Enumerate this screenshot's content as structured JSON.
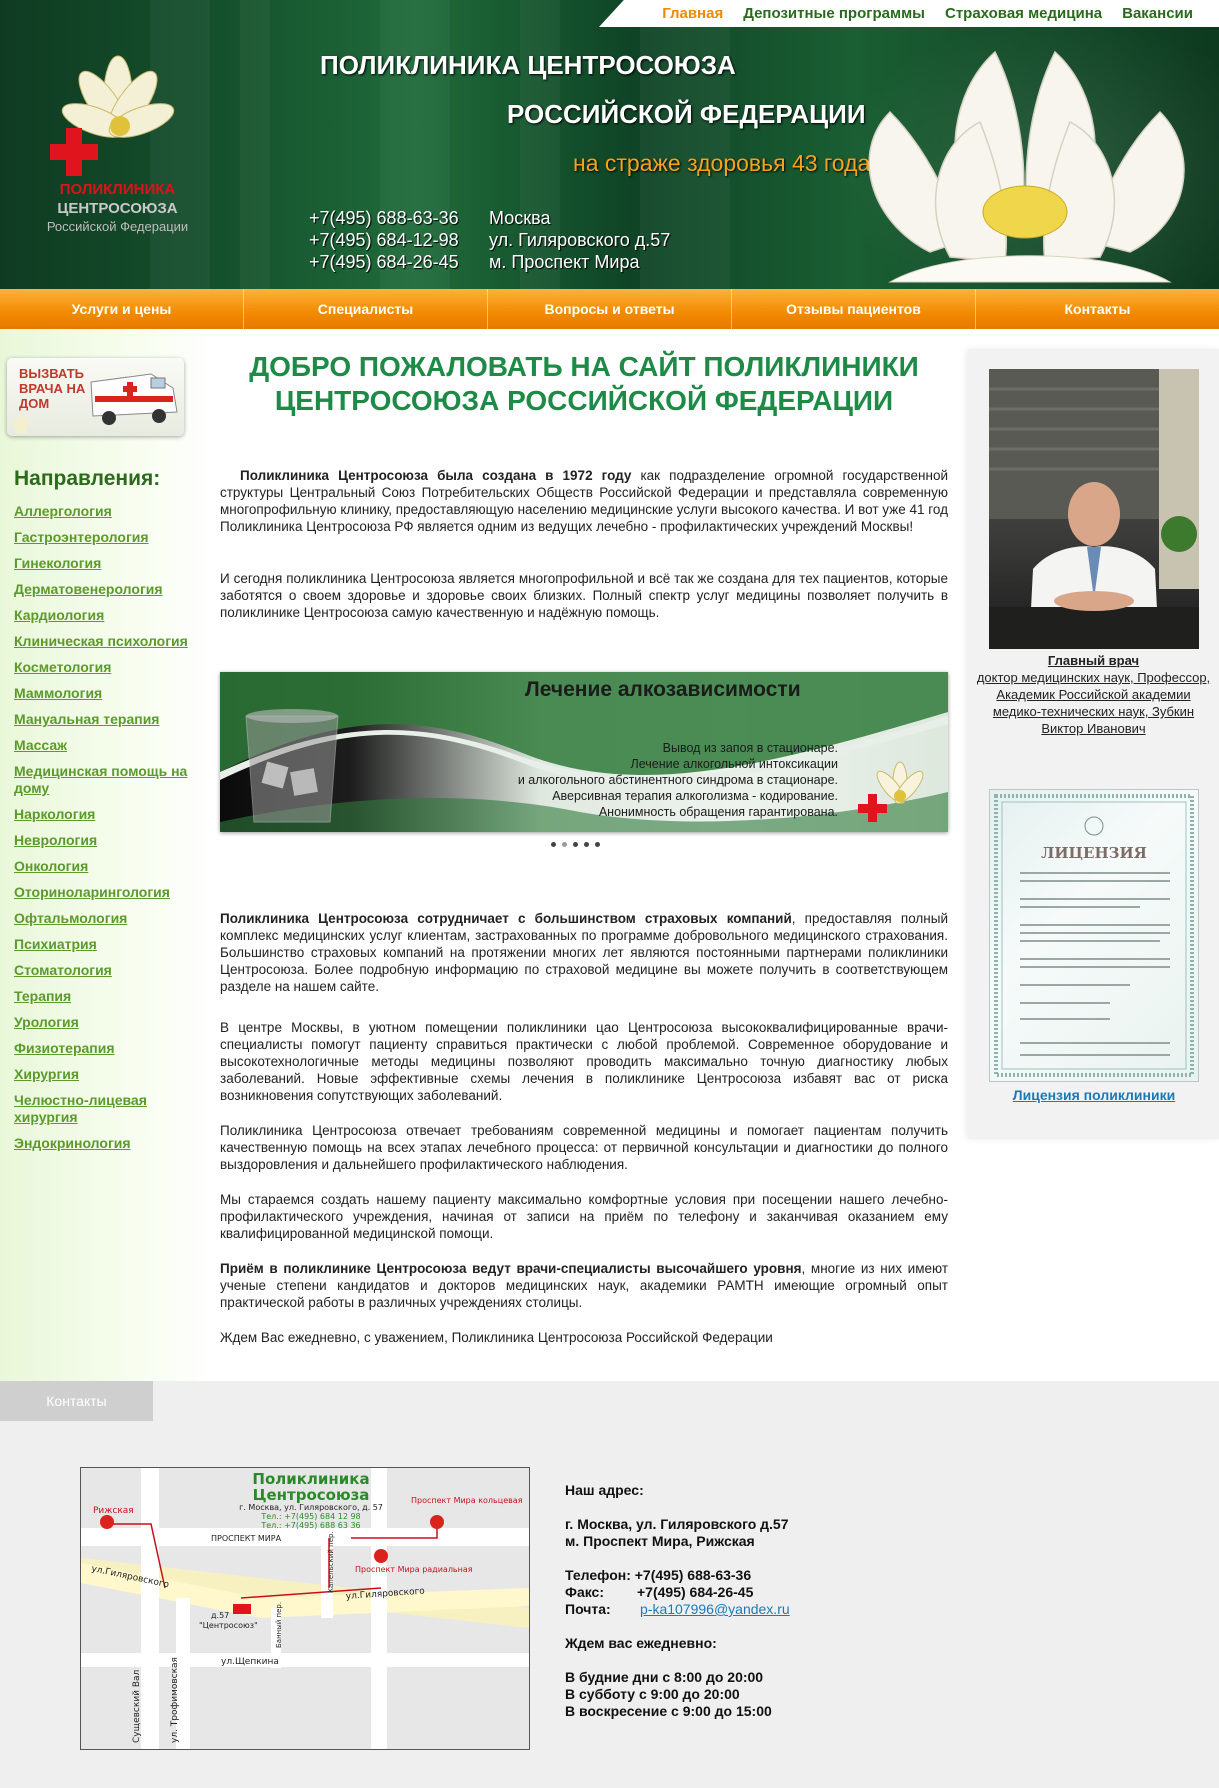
{
  "topnav": {
    "items": [
      {
        "label": "Главная",
        "active": true
      },
      {
        "label": "Депозитные программы"
      },
      {
        "label": "Страховая медицина"
      },
      {
        "label": "Вакансии"
      }
    ]
  },
  "logo": {
    "line1": "ПОЛИКЛИНИКА",
    "line2": "ЦЕНТРОСОЮЗА",
    "line3": "Российской Федерации"
  },
  "header": {
    "title1": "ПОЛИКЛИНИКА ЦЕНТРОСОЮЗА",
    "title2": "РОССИЙСКОЙ ФЕДЕРАЦИИ",
    "slogan": "на страже здоровья 43 года!",
    "phones": [
      "+7(495) 688-63-36",
      "+7(495) 684-12-98",
      "+7(495) 684-26-45"
    ],
    "address": [
      "Москва",
      "ул. Гиляровского д.57",
      "м. Проспект Мира"
    ]
  },
  "mainmenu": [
    "Услуги и цены",
    "Специалисты",
    "Вопросы и ответы",
    "Отзывы пациентов",
    "Контакты"
  ],
  "sidebar": {
    "call_button": "ВЫЗВАТЬ ВРАЧА НА ДОМ",
    "heading": "Направления:",
    "items": [
      "Аллергология",
      "Гастроэнтерология",
      "Гинекология",
      "Дерматовенерология",
      "Кардиология",
      "Клиническая психология",
      "Косметология",
      "Маммология",
      "Мануальная терапия",
      "Массаж",
      "Медицинская помощь на дому",
      "Наркология",
      "Неврология",
      "Онкология",
      "Оториноларингология",
      "Офтальмология",
      "Психиатрия",
      "Стоматология",
      "Терапия",
      "Урология",
      "Физиотерапия",
      "Хирургия",
      "Челюстно-лицевая хирургия",
      "Эндокринология"
    ]
  },
  "main": {
    "welcome": "ДОБРО ПОЖАЛОВАТЬ НА САЙТ ПОЛИКЛИНИКИ ЦЕНТРОСОЮЗА РОССИЙСКОЙ ФЕДЕРАЦИИ",
    "intro_bold": "Поликлиника Центросоюза была создана в 1972 году",
    "intro_rest": " как подразделение огромной государственной структуры Центральный Союз Потребительских Обществ Российской Федерации и представляла современную многопрофильную клинику, предоставляющую населению медицинские услуги высокого качества. И вот уже  41 год Поликлиника Центросоюза РФ является одним из ведущих лечебно - профилактических учреждений  Москвы!",
    "p2": "И сегодня поликлиника Центросоюза является многопрофильной и всё так же создана для тех пациентов, которые заботятся о своем здоровье и здоровье своих близких. Полный спектр услуг медицины позволяет получить в поликлинике Центросоюза самую качественную и надёжную помощь.",
    "banner": {
      "title": "Лечение алкозависимости",
      "lines": [
        "Вывод из запоя в стационаре.",
        "Лечение алкогольной интоксикации",
        "и алкогольного абстинентного синдрома в стационаре.",
        "Аверсивная терапия алкоголизма - кодирование.",
        "Анонимность обращения гарантирована."
      ]
    },
    "p3_bold": "Поликлиника Центросоюза сотрудничает с большинством страховых компаний",
    "p3_rest": ", предоставляя полный комплекс медицинских услуг клиентам, застрахованных по программе добровольного медицинского страхования. Большинство страховых компаний на протяжении многих лет являются постоянными партнерами поликлиники Центросоюза. Более подробную информацию по страховой медицине вы можете получить в соответствующем разделе на нашем сайте.",
    "p4": "В центре Москвы, в уютном помещении  поликлиники цао Центросоюза высококвалифицированные врачи-специалисты помогут пациенту справиться практически с любой проблемой. Современное оборудование и высокотехнологичные методы медицины позволяют проводить максимально точную диагностику любых заболеваний.  Новые эффективные схемы лечения в поликлинике Центросоюза избавят вас от риска возникновения сопутствующих заболеваний.",
    "p5": "Поликлиника Центросоюза отвечает требованиям современной медицины и помогает пациентам получить качественную помощь на всех этапах лечебного процесса: от первичной консультации и диагностики до полного выздоровления и дальнейшего профилактического наблюдения.",
    "p6": "Мы стараемся создать нашему пациенту максимально комфортные условия при посещении нашего лечебно-профилактического учреждения, начиная от записи на приём по телефону и заканчивая оказанием ему квалифицированной медицинской помощи.",
    "p7_bold": "Приём в поликлинике Центросоюза ведут врачи-специалисты высочайшего уровня",
    "p7_rest": ", многие из них имеют ученые степени кандидатов и докторов медицинских наук, академики РАМТН имеющие огромный опыт практической работы в различных учреждениях столицы.",
    "p8": "Ждем Вас ежедневно, с уважением, Поликлиника Центросоюза Российской Федерации"
  },
  "right": {
    "doctor_title": "Главный врач",
    "doctor_desc": "доктор медицинских наук, Профессор, Академик Российской академии медико-технических наук, Зубкин Виктор Иванович",
    "license_link": "Лицензия поликлиники",
    "license_word": "ЛИЦЕНЗИЯ"
  },
  "footer": {
    "tab": "Контакты",
    "map": {
      "title1": "Поликлиника",
      "title2": "Центросоюза",
      "addr": "г. Москва, ул. Гиляровского, д. 57",
      "tel1": "Тел.:  +7(495) 684 12 98",
      "tel2": "Тел.:  +7(495) 688 63 36",
      "rizhskaya": "Рижская",
      "prospekt_kolts": "Проспект Мира кольцевая",
      "prospekt_mira": "ПРОСПЕКТ МИРА",
      "prospekt_rad": "Проспект Мира радиальная",
      "gilyar1": "ул.Гиляровского",
      "gilyar2": "ул.Гиляровского",
      "shchepkina": "ул.Щепкина",
      "sushchevsky": "Сущевский Вал",
      "trofim": "ул. Трофимовская",
      "kapel": "Капельский пер.",
      "bezh": "Банный пер.",
      "d57": "д.57",
      "centrosouz": "\"Центросоюз\""
    },
    "addr_label": "Наш адрес:",
    "addr_lines": [
      "г. Москва, ул. Гиляровского д.57",
      "м. Проспект Мира, Рижская"
    ],
    "phone": "Телефон: +7(495) 688-63-36",
    "fax_label": "Факс:",
    "fax": "+7(495) 684-26-45",
    "mail_label": "Почта:",
    "mail": "p-ka107996@yandex.ru",
    "daily": "Ждем вас ежедневно:",
    "hours": [
      "В будние дни с 8:00 до 20:00",
      "В субботу с 9:00 до 20:00",
      "В воскресение с 9:00 до 15:00"
    ]
  }
}
